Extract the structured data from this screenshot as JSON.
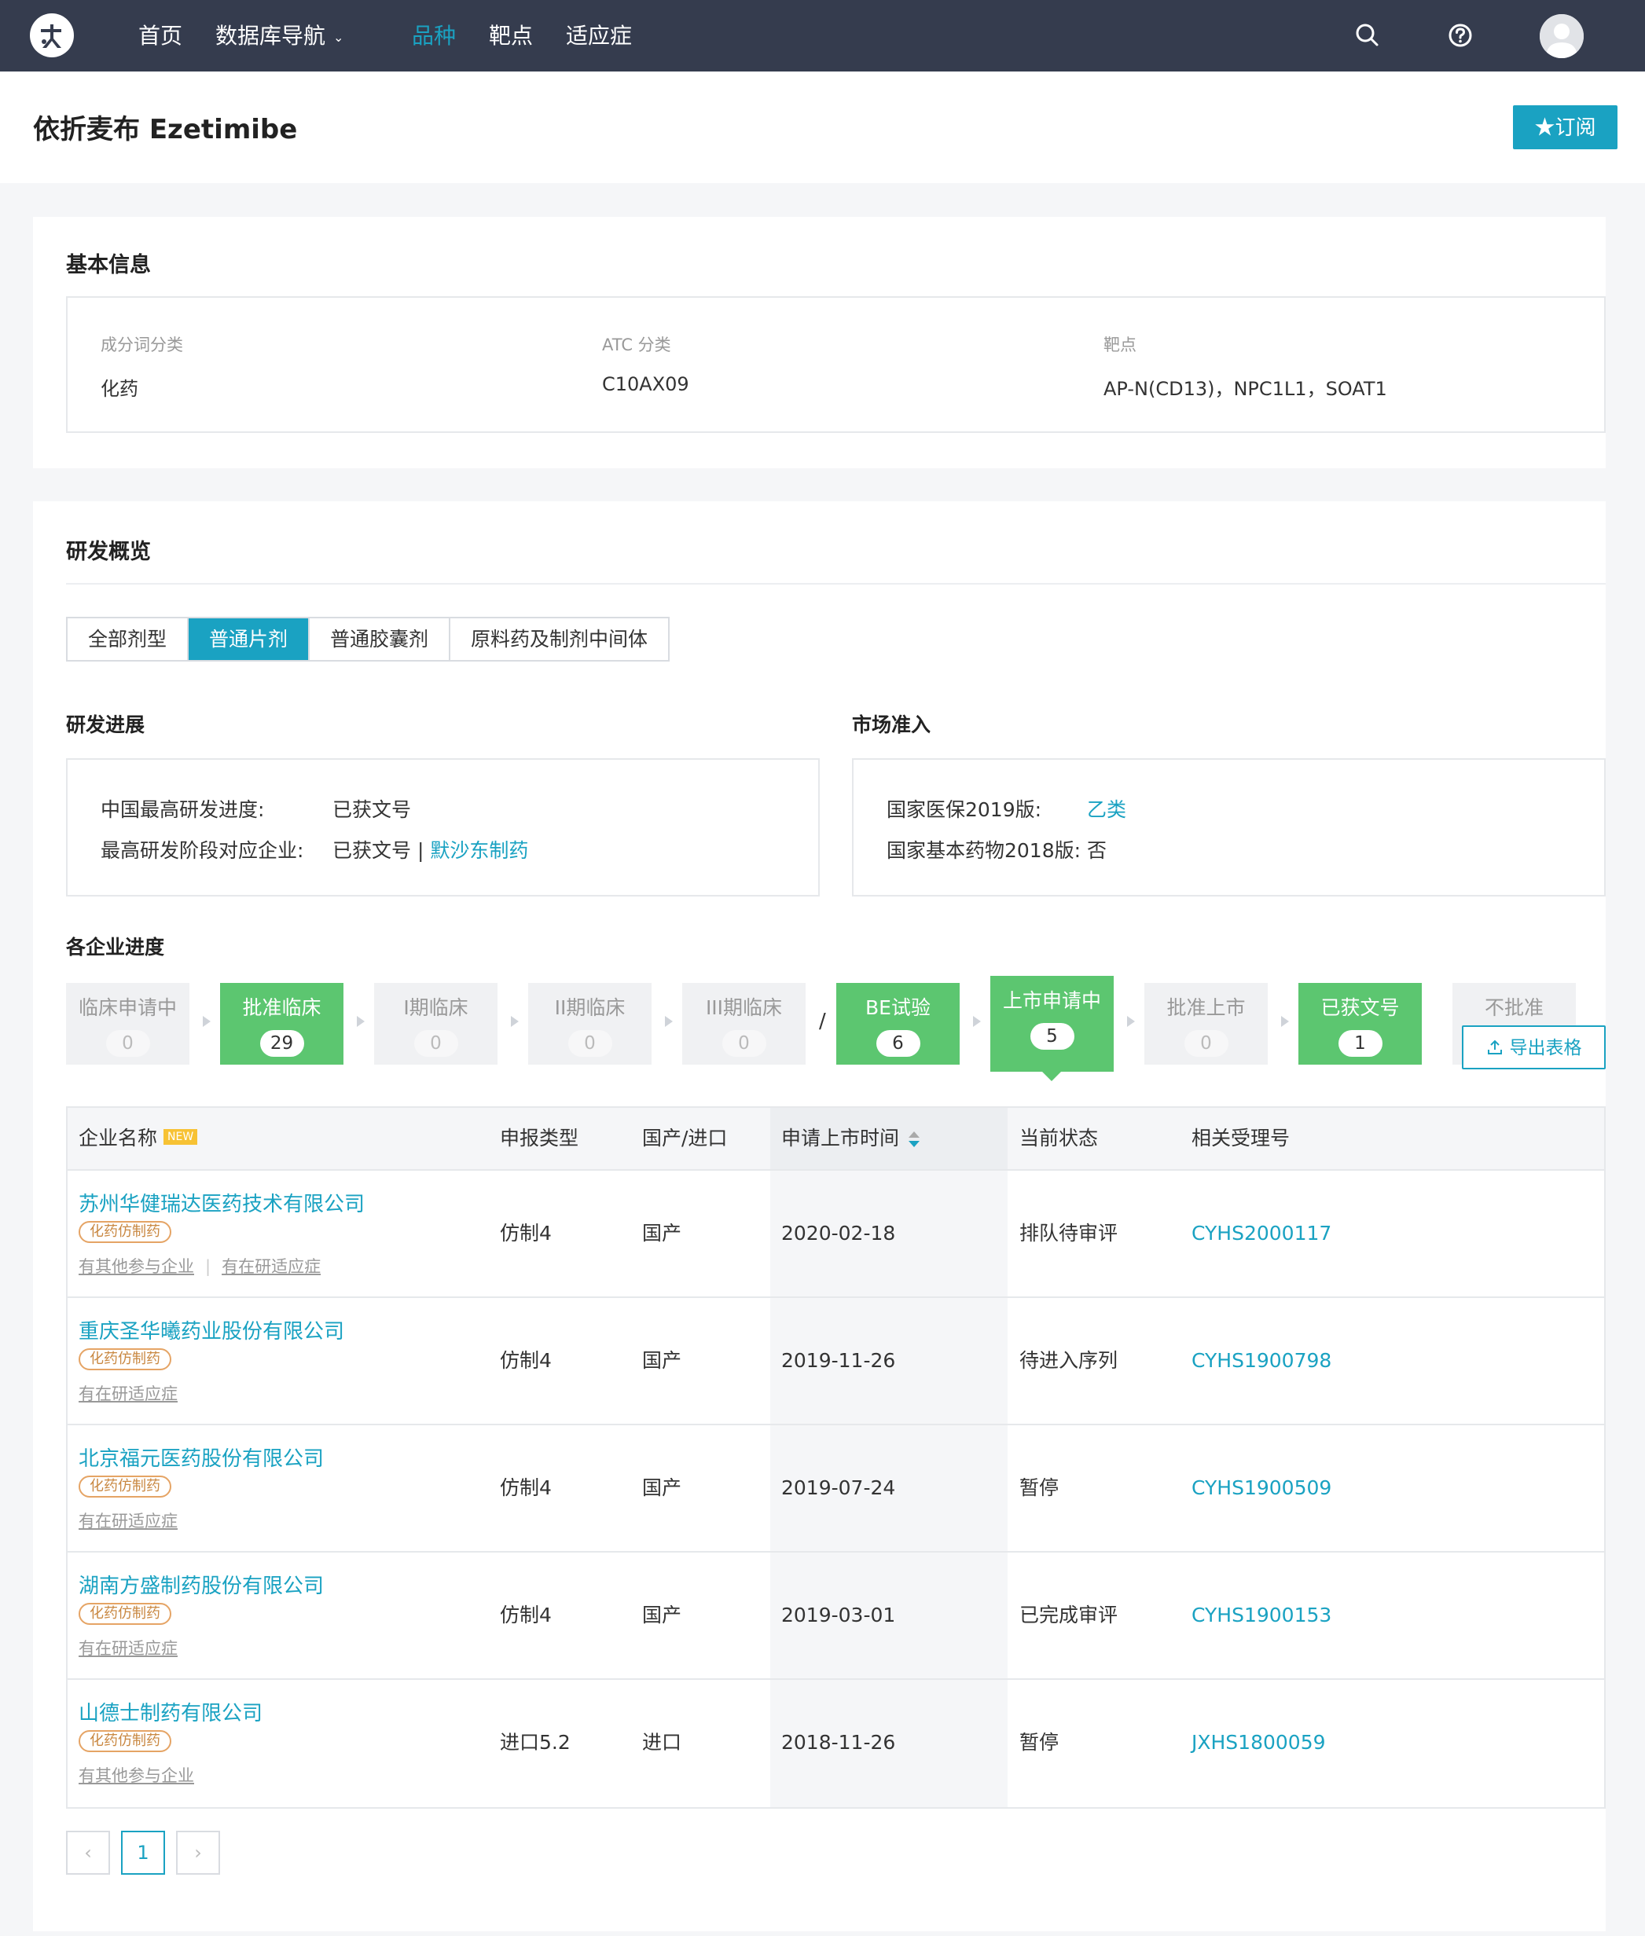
{
  "nav": {
    "items": [
      {
        "label": "首页"
      },
      {
        "label": "数据库导航"
      },
      {
        "label": "品种"
      },
      {
        "label": "靶点"
      },
      {
        "label": "适应症"
      }
    ],
    "active_color": "#1aa2c2",
    "bg_color": "#353c4e"
  },
  "header": {
    "title": "依折麦布 Ezetimibe",
    "subscribe_label": "★订阅"
  },
  "basic": {
    "title": "基本信息",
    "fields": [
      {
        "label": "成分词分类",
        "value": "化药"
      },
      {
        "label": "ATC 分类",
        "value": "C10AX09"
      },
      {
        "label": "靶点",
        "value": "AP-N(CD13)，NPC1L1，SOAT1"
      }
    ]
  },
  "overview": {
    "title": "研发概览",
    "tabs": [
      {
        "label": "全部剂型",
        "active": false
      },
      {
        "label": "普通片剂",
        "active": true
      },
      {
        "label": "普通胶囊剂",
        "active": false
      },
      {
        "label": "原料药及制剂中间体",
        "active": false
      }
    ],
    "progress": {
      "title": "研发进展",
      "rows": [
        {
          "key": "中国最高研发进度:",
          "value": "已获文号"
        },
        {
          "key": "最高研发阶段对应企业:",
          "value": "已获文号 | ",
          "link": "默沙东制药"
        }
      ]
    },
    "market": {
      "title": "市场准入",
      "rows": [
        {
          "key": "国家医保2019版:",
          "value": "乙类"
        },
        {
          "key": "国家基本药物2018版:",
          "value": "否"
        }
      ]
    },
    "stages_title": "各企业进度",
    "stages": [
      {
        "label": "临床申请中",
        "count": "0",
        "state": "off"
      },
      {
        "label": "批准临床",
        "count": "29",
        "state": "on"
      },
      {
        "label": "I期临床",
        "count": "0",
        "state": "off"
      },
      {
        "label": "II期临床",
        "count": "0",
        "state": "off"
      },
      {
        "label": "III期临床",
        "count": "0",
        "state": "off"
      },
      {
        "label": "BE试验",
        "count": "6",
        "state": "on"
      },
      {
        "label": "上市申请中",
        "count": "5",
        "state": "current"
      },
      {
        "label": "批准上市",
        "count": "0",
        "state": "off"
      },
      {
        "label": "已获文号",
        "count": "1",
        "state": "on"
      },
      {
        "label": "不批准",
        "count": "",
        "state": "off"
      }
    ],
    "stage_separator": "/",
    "export_label": "导出表格"
  },
  "table": {
    "headers": {
      "company": "企业名称",
      "new_badge": "NEW",
      "type": "申报类型",
      "origin": "国产/进口",
      "date": "申请上市时间",
      "status": "当前状态",
      "number": "相关受理号"
    },
    "rows": [
      {
        "company": "苏州华健瑞达医药技术有限公司",
        "tag": "化药仿制药",
        "links": [
          "有其他参与企业",
          "有在研适应症"
        ],
        "type": "仿制4",
        "origin": "国产",
        "date": "2020-02-18",
        "status": "排队待审评",
        "number": "CYHS2000117"
      },
      {
        "company": "重庆圣华曦药业股份有限公司",
        "tag": "化药仿制药",
        "links": [
          "有在研适应症"
        ],
        "type": "仿制4",
        "origin": "国产",
        "date": "2019-11-26",
        "status": "待进入序列",
        "number": "CYHS1900798"
      },
      {
        "company": "北京福元医药股份有限公司",
        "tag": "化药仿制药",
        "links": [
          "有在研适应症"
        ],
        "type": "仿制4",
        "origin": "国产",
        "date": "2019-07-24",
        "status": "暂停",
        "number": "CYHS1900509"
      },
      {
        "company": "湖南方盛制药股份有限公司",
        "tag": "化药仿制药",
        "links": [
          "有在研适应症"
        ],
        "type": "仿制4",
        "origin": "国产",
        "date": "2019-03-01",
        "status": "已完成审评",
        "number": "CYHS1900153"
      },
      {
        "company": "山德士制药有限公司",
        "tag": "化药仿制药",
        "links": [
          "有其他参与企业"
        ],
        "type": "进口5.2",
        "origin": "进口",
        "date": "2018-11-26",
        "status": "暂停",
        "number": "JXHS1800059"
      }
    ]
  },
  "pagination": {
    "prev": "‹",
    "current": "1",
    "next": "›"
  }
}
